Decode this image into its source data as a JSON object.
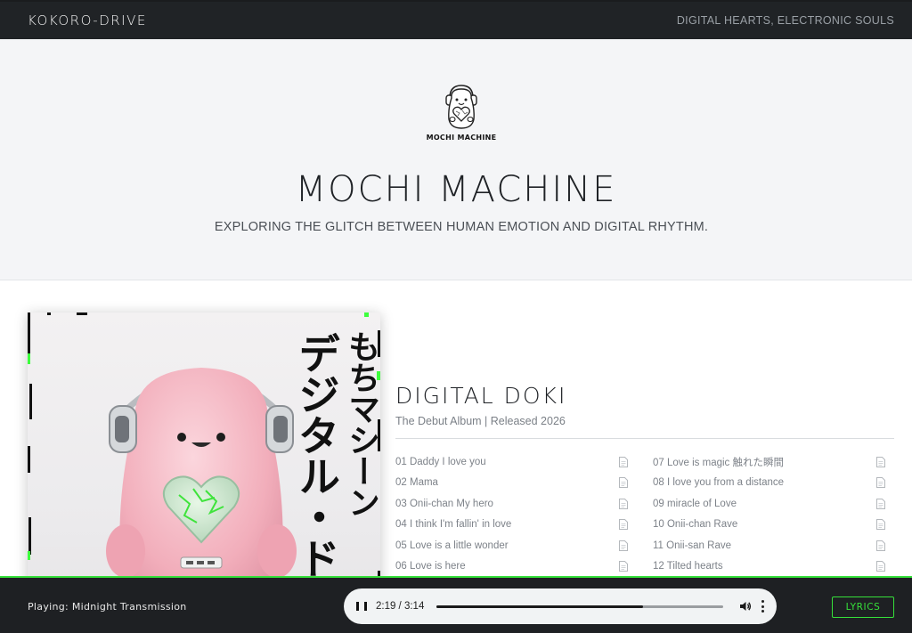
{
  "nav": {
    "brand": "KOKORO-DRIVE",
    "tagline": "DIGITAL HEARTS, ELECTRONIC SOULS"
  },
  "hero": {
    "logo_label": "MOCHI MACHINE",
    "title": "MOCHI MACHINE",
    "subtitle": "EXPLORING THE GLITCH BETWEEN HUMAN EMOTION AND DIGITAL RHYTHM."
  },
  "album": {
    "cover_text_col1": "もちマシーン",
    "cover_text_col2": "デジタル・ドキ",
    "title": "DIGITAL DOKI",
    "meta": "The Debut Album | Released 2026",
    "tracks": [
      "01 Daddy I love you",
      "07 Love is magic 触れた瞬間",
      "02 Mama",
      "08 I love you from a distance",
      "03 Onii-chan My hero",
      "09 miracle of Love",
      "04 I think I'm fallin' in love",
      "10 Onii-chan Rave",
      "05 Love is a little wonder",
      "11 Onii-san Rave",
      "06 Love is here",
      "12 Tilted hearts"
    ],
    "track_icon": "document-icon"
  },
  "player": {
    "now_playing": "Playing: Midnight Transmission",
    "time": "2:19 / 3:14",
    "progress": 0.72,
    "lyrics_label": "LYRICS",
    "accent": "#36e03a"
  }
}
